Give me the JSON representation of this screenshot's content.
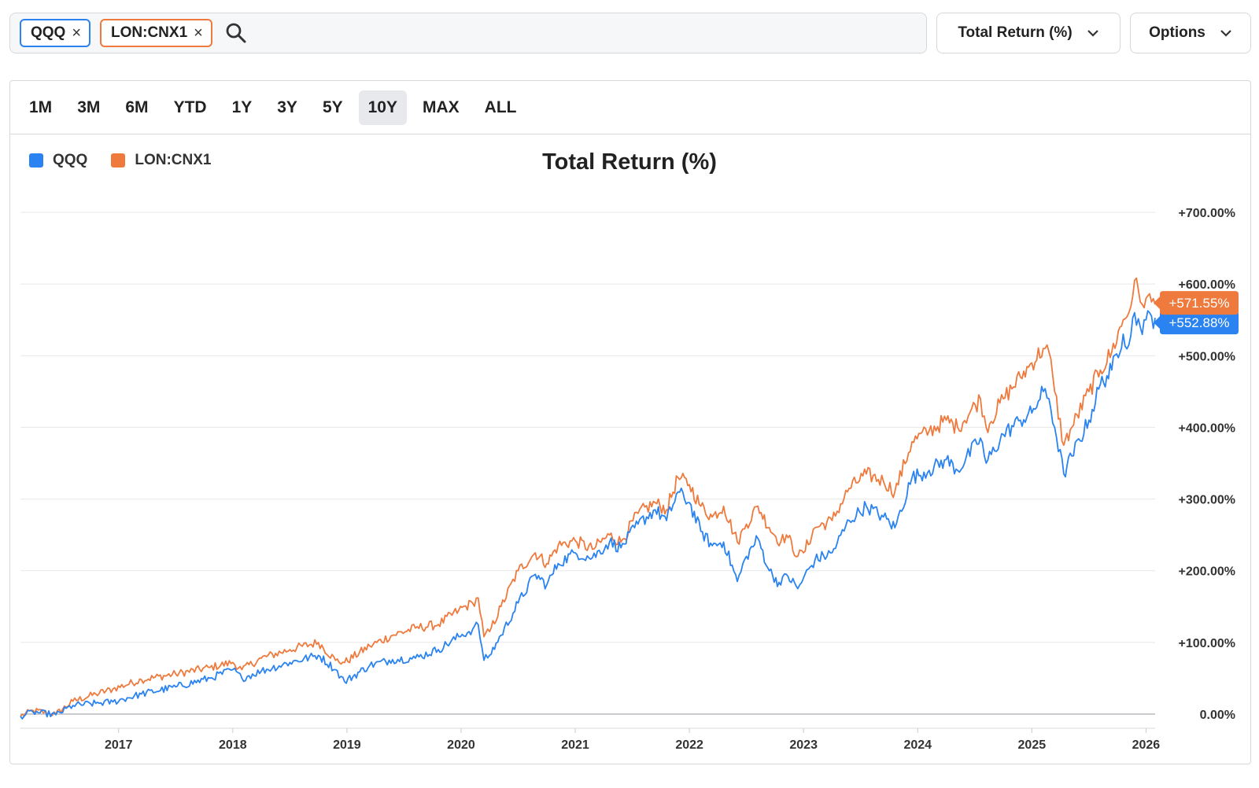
{
  "search": {
    "chips": [
      {
        "label": "QQQ",
        "close": "×"
      },
      {
        "label": "LON:CNX1",
        "close": "×"
      }
    ]
  },
  "controls": {
    "metric_label": "Total Return (%)",
    "options_label": "Options"
  },
  "ranges": [
    "1M",
    "3M",
    "6M",
    "YTD",
    "1Y",
    "3Y",
    "5Y",
    "10Y",
    "MAX",
    "ALL"
  ],
  "active_range": "10Y",
  "colors": {
    "qqq": "#2a83f0",
    "cnx1": "#ee7a3d",
    "grid": "#e6e7ea",
    "axis_text": "#333333"
  },
  "chart_data": {
    "type": "line",
    "title": "Total Return (%)",
    "xlabel": "",
    "ylabel": "",
    "y_ticks": [
      "+700.00%",
      "+600.00%",
      "+500.00%",
      "+400.00%",
      "+300.00%",
      "+200.00%",
      "+100.00%",
      "0.00%"
    ],
    "y_tick_values": [
      700,
      600,
      500,
      400,
      300,
      200,
      100,
      0
    ],
    "ylim": [
      0,
      700
    ],
    "x_ticks": [
      "2017",
      "2018",
      "2019",
      "2020",
      "2021",
      "2022",
      "2023",
      "2024",
      "2025",
      "2026"
    ],
    "x_tick_values": [
      2017,
      2018,
      2019,
      2020,
      2021,
      2022,
      2023,
      2024,
      2025,
      2026
    ],
    "xlim": [
      2016.14,
      2026.08
    ],
    "legend_position": "top-left",
    "grid": true,
    "series": [
      {
        "name": "QQQ",
        "color": "#2a83f0",
        "last_value_label": "+552.88%",
        "points": [
          [
            2016.14,
            -3
          ],
          [
            2016.25,
            3
          ],
          [
            2016.45,
            -1
          ],
          [
            2016.6,
            12
          ],
          [
            2016.8,
            15
          ],
          [
            2016.95,
            17
          ],
          [
            2017.2,
            28
          ],
          [
            2017.5,
            38
          ],
          [
            2017.8,
            50
          ],
          [
            2018.0,
            62
          ],
          [
            2018.08,
            50
          ],
          [
            2018.25,
            60
          ],
          [
            2018.5,
            72
          ],
          [
            2018.75,
            82
          ],
          [
            2018.9,
            62
          ],
          [
            2018.98,
            45
          ],
          [
            2019.2,
            68
          ],
          [
            2019.4,
            76
          ],
          [
            2019.6,
            78
          ],
          [
            2019.8,
            90
          ],
          [
            2019.98,
            108
          ],
          [
            2020.1,
            118
          ],
          [
            2020.15,
            125
          ],
          [
            2020.2,
            75
          ],
          [
            2020.25,
            82
          ],
          [
            2020.35,
            110
          ],
          [
            2020.5,
            155
          ],
          [
            2020.65,
            195
          ],
          [
            2020.75,
            180
          ],
          [
            2020.85,
            210
          ],
          [
            2021.0,
            225
          ],
          [
            2021.15,
            218
          ],
          [
            2021.3,
            240
          ],
          [
            2021.4,
            232
          ],
          [
            2021.55,
            265
          ],
          [
            2021.7,
            285
          ],
          [
            2021.8,
            270
          ],
          [
            2021.9,
            310
          ],
          [
            2022.0,
            295
          ],
          [
            2022.1,
            255
          ],
          [
            2022.2,
            235
          ],
          [
            2022.3,
            240
          ],
          [
            2022.42,
            185
          ],
          [
            2022.5,
            220
          ],
          [
            2022.6,
            245
          ],
          [
            2022.7,
            200
          ],
          [
            2022.8,
            180
          ],
          [
            2022.85,
            195
          ],
          [
            2022.95,
            175
          ],
          [
            2023.0,
            190
          ],
          [
            2023.1,
            215
          ],
          [
            2023.25,
            225
          ],
          [
            2023.4,
            270
          ],
          [
            2023.55,
            290
          ],
          [
            2023.7,
            275
          ],
          [
            2023.8,
            260
          ],
          [
            2023.95,
            330
          ],
          [
            2024.1,
            340
          ],
          [
            2024.25,
            355
          ],
          [
            2024.35,
            340
          ],
          [
            2024.55,
            385
          ],
          [
            2024.6,
            350
          ],
          [
            2024.75,
            390
          ],
          [
            2024.9,
            410
          ],
          [
            2025.0,
            420
          ],
          [
            2025.1,
            450
          ],
          [
            2025.15,
            440
          ],
          [
            2025.2,
            400
          ],
          [
            2025.28,
            335
          ],
          [
            2025.35,
            360
          ],
          [
            2025.5,
            410
          ],
          [
            2025.6,
            460
          ],
          [
            2025.7,
            480
          ],
          [
            2025.8,
            530
          ],
          [
            2025.85,
            515
          ],
          [
            2025.9,
            560
          ],
          [
            2025.95,
            540
          ],
          [
            2026.0,
            550
          ],
          [
            2026.08,
            552.88
          ]
        ]
      },
      {
        "name": "LON:CNX1",
        "color": "#ee7a3d",
        "last_value_label": "+571.55%",
        "points": [
          [
            2016.14,
            -3
          ],
          [
            2016.25,
            5
          ],
          [
            2016.45,
            0
          ],
          [
            2016.6,
            18
          ],
          [
            2016.8,
            28
          ],
          [
            2016.95,
            35
          ],
          [
            2017.2,
            48
          ],
          [
            2017.5,
            56
          ],
          [
            2017.8,
            65
          ],
          [
            2018.0,
            72
          ],
          [
            2018.08,
            62
          ],
          [
            2018.25,
            78
          ],
          [
            2018.5,
            90
          ],
          [
            2018.75,
            100
          ],
          [
            2018.9,
            75
          ],
          [
            2018.98,
            72
          ],
          [
            2019.2,
            95
          ],
          [
            2019.4,
            110
          ],
          [
            2019.6,
            120
          ],
          [
            2019.8,
            125
          ],
          [
            2019.98,
            145
          ],
          [
            2020.1,
            155
          ],
          [
            2020.15,
            162
          ],
          [
            2020.2,
            108
          ],
          [
            2020.25,
            115
          ],
          [
            2020.35,
            150
          ],
          [
            2020.5,
            200
          ],
          [
            2020.65,
            225
          ],
          [
            2020.75,
            210
          ],
          [
            2020.85,
            235
          ],
          [
            2021.0,
            242
          ],
          [
            2021.15,
            230
          ],
          [
            2021.3,
            250
          ],
          [
            2021.4,
            240
          ],
          [
            2021.55,
            280
          ],
          [
            2021.7,
            295
          ],
          [
            2021.8,
            285
          ],
          [
            2021.9,
            330
          ],
          [
            2022.0,
            320
          ],
          [
            2022.1,
            290
          ],
          [
            2022.2,
            275
          ],
          [
            2022.3,
            290
          ],
          [
            2022.42,
            240
          ],
          [
            2022.5,
            265
          ],
          [
            2022.6,
            290
          ],
          [
            2022.7,
            260
          ],
          [
            2022.8,
            240
          ],
          [
            2022.85,
            250
          ],
          [
            2022.95,
            220
          ],
          [
            2023.0,
            225
          ],
          [
            2023.1,
            260
          ],
          [
            2023.25,
            270
          ],
          [
            2023.4,
            315
          ],
          [
            2023.55,
            335
          ],
          [
            2023.7,
            325
          ],
          [
            2023.8,
            310
          ],
          [
            2023.95,
            380
          ],
          [
            2024.1,
            395
          ],
          [
            2024.25,
            410
          ],
          [
            2024.35,
            400
          ],
          [
            2024.55,
            440
          ],
          [
            2024.6,
            400
          ],
          [
            2024.75,
            440
          ],
          [
            2024.9,
            470
          ],
          [
            2025.0,
            490
          ],
          [
            2025.1,
            510
          ],
          [
            2025.15,
            505
          ],
          [
            2025.2,
            450
          ],
          [
            2025.28,
            375
          ],
          [
            2025.35,
            400
          ],
          [
            2025.5,
            450
          ],
          [
            2025.6,
            480
          ],
          [
            2025.7,
            505
          ],
          [
            2025.8,
            550
          ],
          [
            2025.85,
            560
          ],
          [
            2025.9,
            605
          ],
          [
            2025.95,
            575
          ],
          [
            2026.0,
            580
          ],
          [
            2026.08,
            571.55
          ]
        ]
      }
    ]
  }
}
